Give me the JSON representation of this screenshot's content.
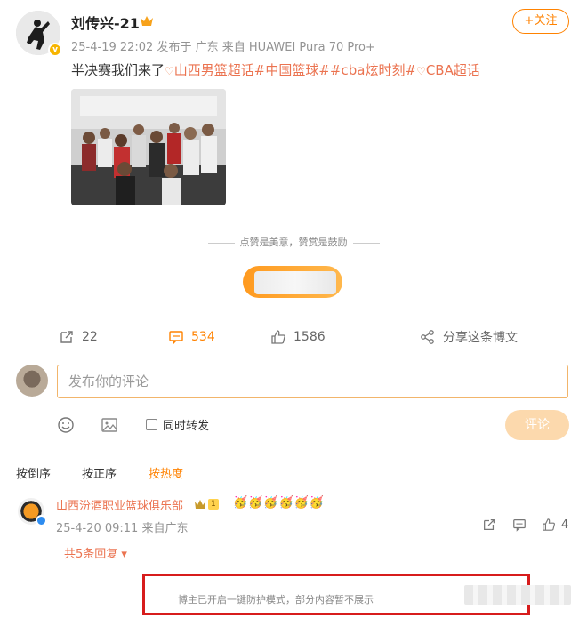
{
  "post": {
    "author": "刘传兴-21",
    "timestamp": "25-4-19 22:02",
    "location": "发布于 广东",
    "device": "来自 HUAWEI Pura 70 Pro+",
    "follow_label": "+关注",
    "text_prefix": "半决赛我们来了",
    "tags": [
      "山西男篮超话",
      "#中国篮球#",
      "#cba炫时刻#",
      "CBA超话"
    ]
  },
  "reward": {
    "tip": "点赞是美意，赞赏是鼓励"
  },
  "actions": {
    "repost_count": "22",
    "comment_count": "534",
    "like_count": "1586",
    "share_label": "分享这条博文"
  },
  "composer": {
    "placeholder": "发布你的评论",
    "repost_label": "同时转发",
    "submit_label": "评论"
  },
  "sort_tabs": [
    "按倒序",
    "按正序",
    "按热度"
  ],
  "comment": {
    "author": "山西汾酒职业篮球俱乐部",
    "level": "1",
    "emoji_text": "🥳🥳🥳🥳🥳🥳",
    "timestamp": "25-4-20 09:11",
    "source": "来自广东",
    "like_count": "4",
    "replies_label": "共5条回复"
  },
  "notice": {
    "text": "博主已开启一键防护模式，部分内容暂不展示"
  },
  "colors": {
    "accent": "#ff8200",
    "tag": "#eb7350",
    "notice_border": "#d71c1c"
  }
}
